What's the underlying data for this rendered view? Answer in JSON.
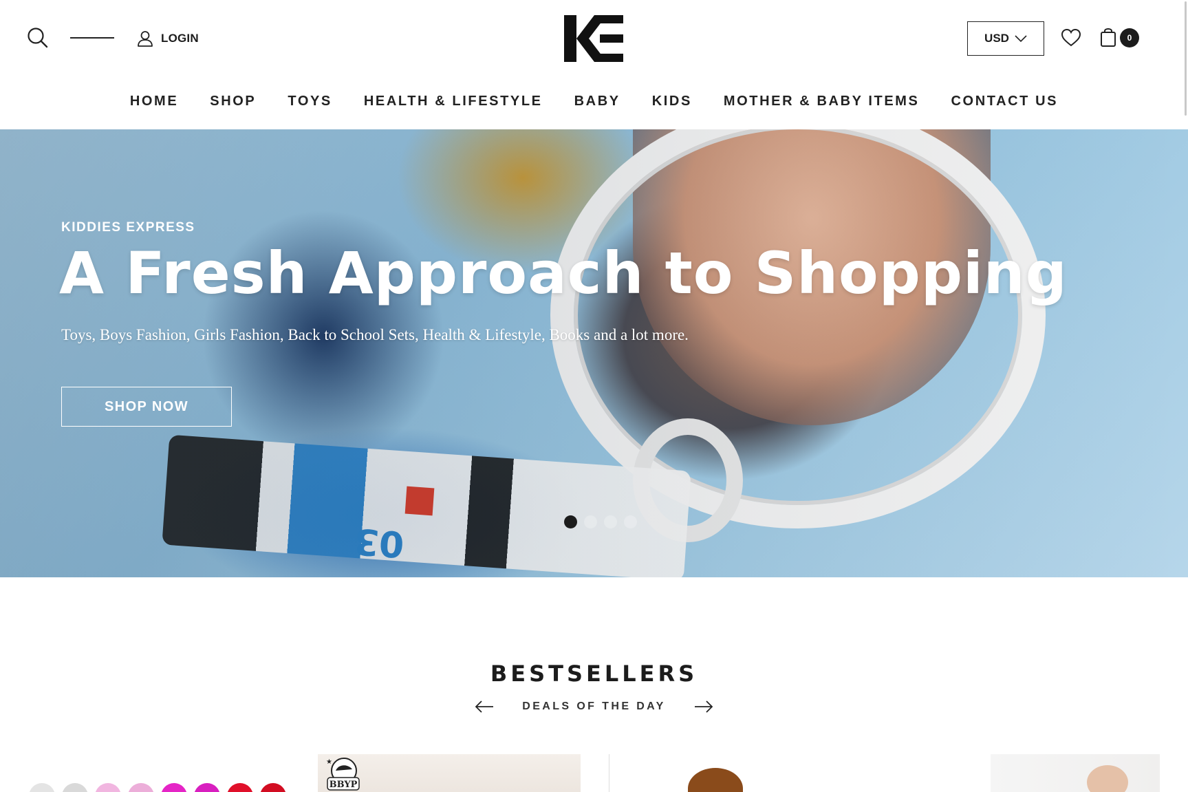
{
  "header": {
    "login_label": "LOGIN",
    "currency_label": "USD",
    "cart_count": "0",
    "logo_alt": "KE"
  },
  "nav": {
    "items": [
      {
        "label": "HOME"
      },
      {
        "label": "SHOP"
      },
      {
        "label": "TOYS"
      },
      {
        "label": "HEALTH & LIFESTYLE"
      },
      {
        "label": "BABY"
      },
      {
        "label": "KIDS"
      },
      {
        "label": "MOTHER & BABY ITEMS"
      },
      {
        "label": "CONTACT US"
      }
    ]
  },
  "hero": {
    "eyebrow": "KIDDIES EXPRESS",
    "title": "A Fresh Approach to Shopping",
    "subtitle": "Toys, Boys Fashion, Girls Fashion, Back to School Sets, Health & Lifestyle, Books and a lot more.",
    "button_label": "SHOP NOW",
    "slide_count": 4,
    "active_slide": 1,
    "image_text": "03"
  },
  "bestsellers": {
    "title": "BESTSELLERS",
    "subtitle": "DEALS OF THE DAY",
    "brand_badge": "BBYP"
  },
  "colors": {
    "text": "#1c1c1c",
    "hero_bg": "#9ac6e0",
    "white": "#ffffff"
  },
  "icons": [
    "search-icon",
    "menu-icon",
    "user-icon",
    "chevron-down-icon",
    "heart-icon",
    "shopping-bag-icon",
    "arrow-left-icon",
    "arrow-right-icon"
  ]
}
